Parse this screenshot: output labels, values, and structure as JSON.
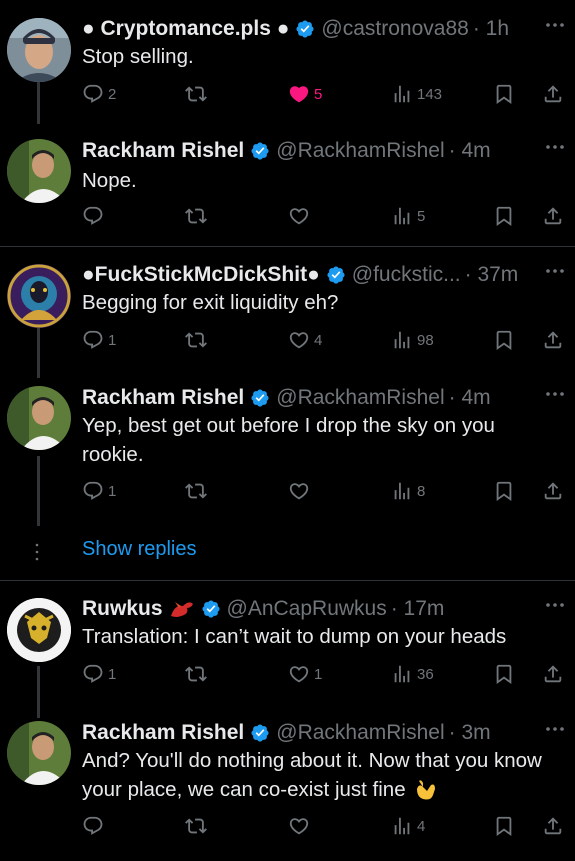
{
  "tweets": [
    {
      "name": "● Cryptomance.pls ●",
      "handle": "@castronova88",
      "time": "· 1h",
      "text": "Stop selling.",
      "replies": "2",
      "retweets": "",
      "likes": "5",
      "views": "143",
      "liked": true
    },
    {
      "name": "Rackham Rishel",
      "handle": "@RackhamRishel",
      "time": "· 4m",
      "text": "Nope.",
      "replies": "",
      "retweets": "",
      "likes": "",
      "views": "5"
    },
    {
      "name": "●FuckStickMcDickShit●",
      "handle": "@fuckstic...",
      "time": "· 37m",
      "text": "Begging for exit liquidity eh?",
      "replies": "1",
      "retweets": "",
      "likes": "4",
      "views": "98"
    },
    {
      "name": "Rackham Rishel",
      "handle": "@RackhamRishel",
      "time": "· 4m",
      "text": "Yep, best get out before I drop the sky on you rookie.",
      "replies": "1",
      "retweets": "",
      "likes": "",
      "views": "8"
    },
    {
      "name": "Ruwkus",
      "handle": "@AnCapRuwkus",
      "time": "· 17m",
      "text": "Translation: I can’t wait to dump on your heads",
      "replies": "1",
      "retweets": "",
      "likes": "1",
      "views": "36"
    },
    {
      "name": "Rackham Rishel",
      "handle": "@RackhamRishel",
      "time": "· 3m",
      "text": "And? You'll do nothing about it. Now that you know your place, we can co-exist just fine",
      "replies": "",
      "retweets": "",
      "likes": "",
      "views": "4"
    }
  ],
  "show_replies": "Show replies",
  "icons": {
    "reply": "reply-icon",
    "retweet": "retweet-icon",
    "like": "heart-icon",
    "views": "views-icon",
    "bookmark": "bookmark-icon",
    "share": "share-icon",
    "verified": "verified-badge-icon",
    "more": "more-icon"
  },
  "colors": {
    "background": "#000000",
    "text": "#e7e9ea",
    "secondary": "#71767b",
    "link": "#1d9bf0",
    "verified": "#1d9bf0",
    "liked": "#f91880"
  }
}
